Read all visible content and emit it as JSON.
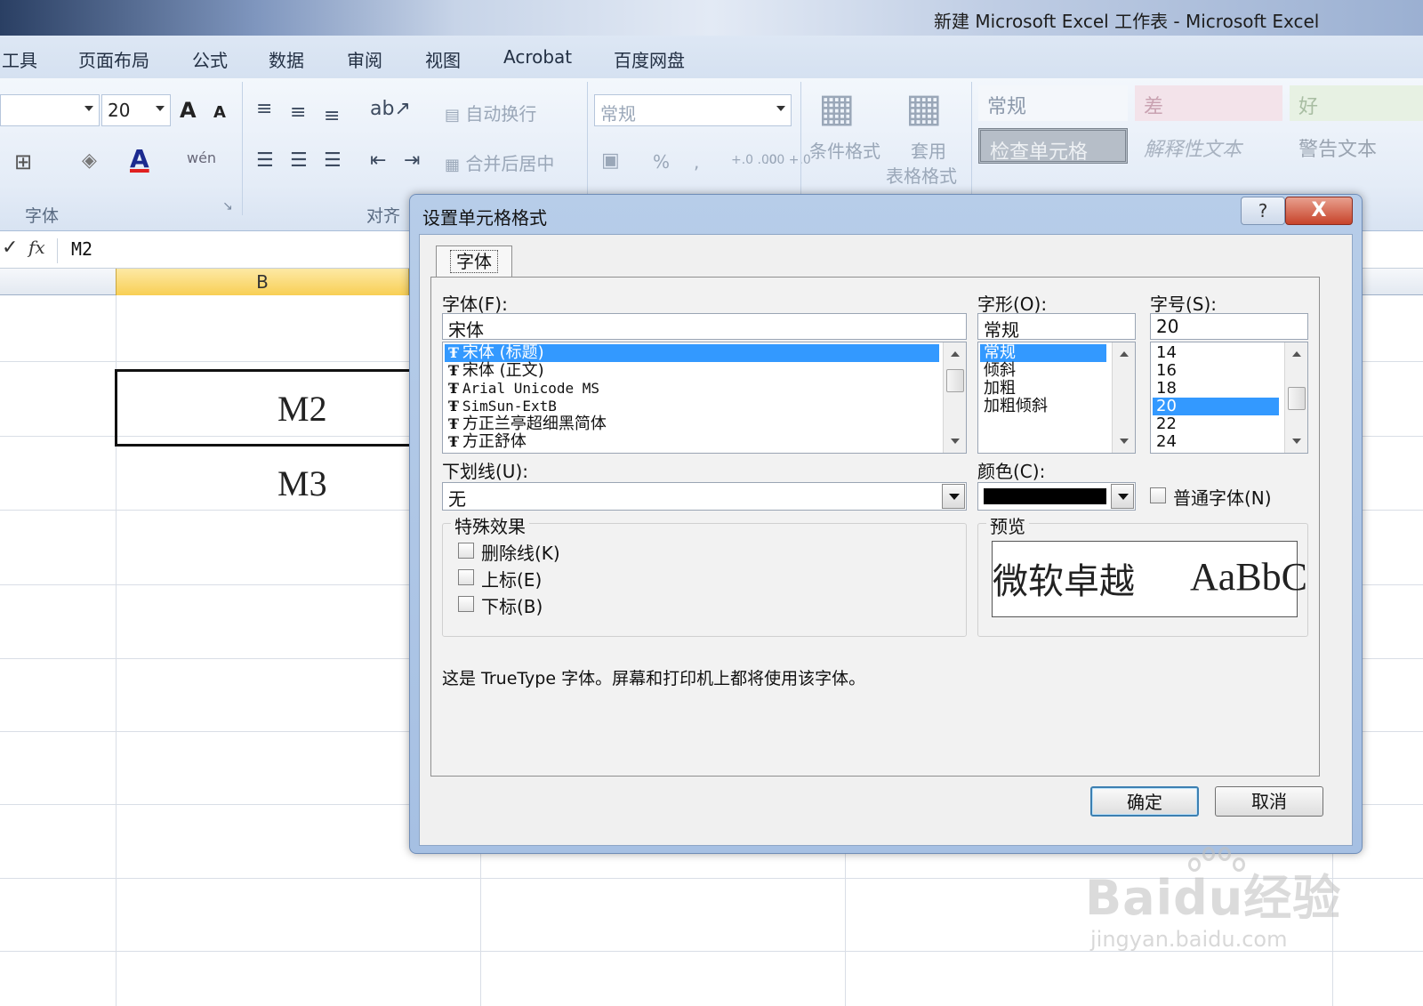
{
  "window": {
    "title": "新建 Microsoft Excel 工作表 - Microsoft Excel"
  },
  "menu": {
    "tabs": [
      "工具",
      "页面布局",
      "公式",
      "数据",
      "审阅",
      "视图",
      "Acrobat",
      "百度网盘"
    ]
  },
  "ribbon": {
    "font_size": "20",
    "grow_font": "A",
    "shrink_font": "A",
    "font_color_glyph": "A",
    "phonetic_glyph": "wén",
    "wrap_text": "自动换行",
    "merge_center": "合并后居中",
    "number_format": "常规",
    "percent": "%",
    "comma": ",",
    "inc_decimal": "+.0 .00",
    "dec_decimal": ".00 +.0",
    "conditional_format": "条件格式",
    "format_table_top": "套用",
    "format_table_bottom": "表格格式",
    "styles": {
      "normal": "常规",
      "bad": "差",
      "good": "好",
      "check_cell": "检查单元格",
      "explanatory": "解释性文本",
      "warning": "警告文本"
    },
    "group_font": "字体",
    "group_align": "对齐"
  },
  "formula_bar": {
    "content": "M2"
  },
  "sheet": {
    "column_b": "B",
    "cells": {
      "b2": "M2",
      "b3": "M3"
    }
  },
  "dialog": {
    "title": "设置单元格格式",
    "help": "?",
    "close": "X",
    "tab": "字体",
    "font_label": "字体(F):",
    "font_value": "宋体",
    "font_list": [
      {
        "name": "宋体 (标题)",
        "selected": true
      },
      {
        "name": "宋体 (正文)",
        "selected": false
      },
      {
        "name": "Arial Unicode MS",
        "selected": false
      },
      {
        "name": "SimSun-ExtB",
        "selected": false
      },
      {
        "name": "方正兰亭超细黑简体",
        "selected": false
      },
      {
        "name": "方正舒体",
        "selected": false
      }
    ],
    "style_label": "字形(O):",
    "style_value": "常规",
    "style_list": [
      "常规",
      "倾斜",
      "加粗",
      "加粗倾斜"
    ],
    "size_label": "字号(S):",
    "size_value": "20",
    "size_list": [
      "14",
      "16",
      "18",
      "20",
      "22",
      "24"
    ],
    "underline_label": "下划线(U):",
    "underline_value": "无",
    "color_label": "颜色(C):",
    "color_value": "#000000",
    "normal_font_label": "普通字体(N)",
    "effects_label": "特殊效果",
    "strikethrough": "删除线(K)",
    "superscript": "上标(E)",
    "subscript": "下标(B)",
    "preview_label": "预览",
    "preview_text_cn": "微软卓越",
    "preview_text_en": "AaBbC",
    "info": "这是 TrueType 字体。屏幕和打印机上都将使用该字体。",
    "ok": "确定",
    "cancel": "取消"
  },
  "watermark": {
    "brand": "Baidu经验",
    "url": "jingyan.baidu.com"
  }
}
